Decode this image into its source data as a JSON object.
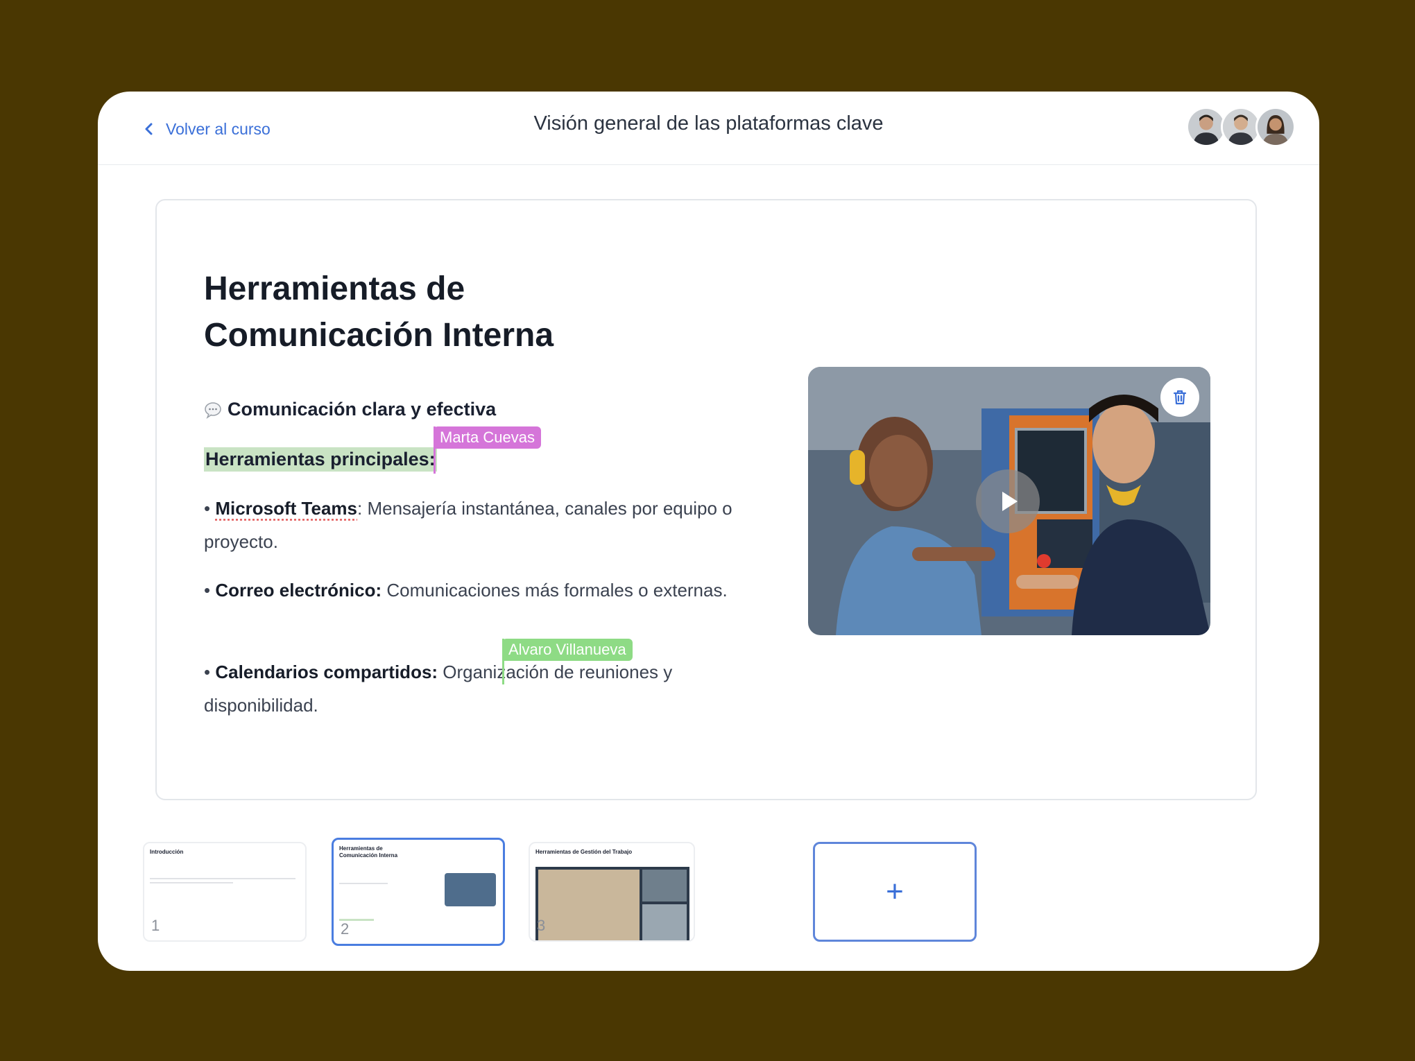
{
  "header": {
    "back_label": "Volver al curso",
    "title": "Visión general de las plataformas clave"
  },
  "slide": {
    "heading": "Herramientas de Comunicación Interna",
    "subheading": "Comunicación clara y efectiva",
    "tools_label": "Herramientas principales:",
    "bullets": [
      {
        "term": "Microsoft Teams",
        "text": ": Mensajería instantánea, canales por equipo o proyecto."
      },
      {
        "term": "Correo electrónico:",
        "text": " Comunicaciones más formales o externas."
      },
      {
        "term": "Calendarios compartidos:",
        "text": " Organización de reuniones y disponibilidad."
      }
    ],
    "collaborators": [
      "Marta Cuevas",
      "Alvaro Villanueva"
    ]
  },
  "thumbnails": [
    {
      "title": "Introducción",
      "number": "1"
    },
    {
      "title": "Herramientas de Comunicación Interna",
      "number": "2"
    },
    {
      "title": "Herramientas de Gestión del Trabajo",
      "number": "3"
    }
  ],
  "add_label": "+",
  "colors": {
    "accent": "#3a6fd8",
    "marta": "#d575d9",
    "alvaro": "#8edb85",
    "highlight": "#c9e3c4"
  }
}
